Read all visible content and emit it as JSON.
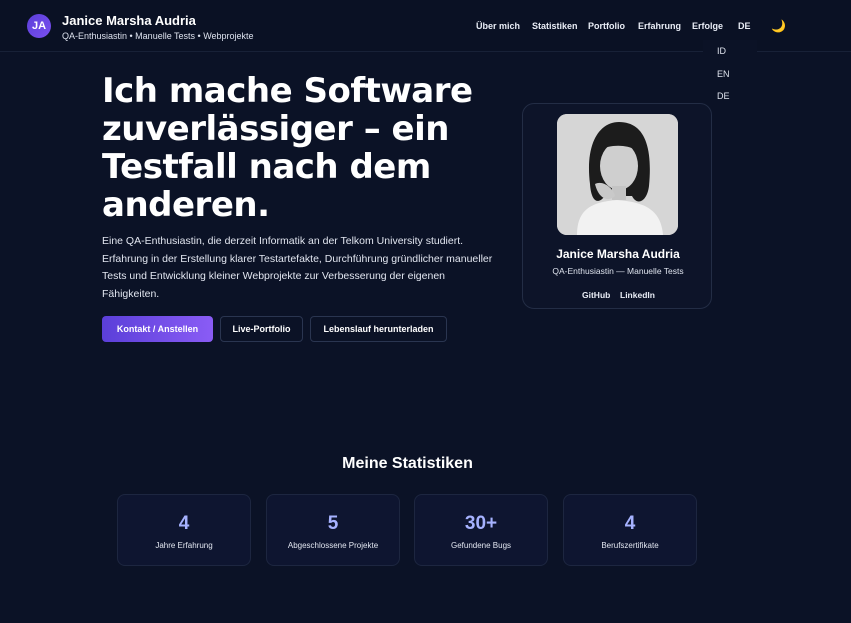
{
  "header": {
    "avatar_initials": "JA",
    "name": "Janice Marsha Audria",
    "subtitle": "QA-Enthusiastin • Manuelle Tests • Webprojekte",
    "nav": [
      "Über mich",
      "Statistiken",
      "Portfolio",
      "Erfahrung",
      "Erfolge"
    ],
    "language_current": "DE",
    "language_options": [
      "ID",
      "EN",
      "DE"
    ],
    "theme_icon": "moon-icon"
  },
  "hero": {
    "title": "Ich mache Software zuverlässiger – ein Testfall nach dem anderen.",
    "description": "Eine QA-Enthusiastin, die derzeit Informatik an der Telkom University studiert. Erfahrung in der Erstellung klarer Testartefakte, Durchführung gründlicher manueller Tests und Entwicklung kleiner Webprojekte zur Verbesserung der eigenen Fähigkeiten.",
    "buttons": {
      "contact": "Kontakt / Anstellen",
      "portfolio": "Live-Portfolio",
      "cv": "Lebenslauf herunterladen"
    }
  },
  "profile": {
    "name": "Janice Marsha Audria",
    "role": "QA-Enthusiastin — Manuelle Tests",
    "links": [
      "GitHub",
      "LinkedIn"
    ]
  },
  "stats": {
    "heading": "Meine Statistiken",
    "items": [
      {
        "value": "4",
        "label": "Jahre Erfahrung"
      },
      {
        "value": "5",
        "label": "Abgeschlossene Projekte"
      },
      {
        "value": "30+",
        "label": "Gefundene Bugs"
      },
      {
        "value": "4",
        "label": "Berufszertifikate"
      }
    ]
  },
  "colors": {
    "background": "#0b1226",
    "accent": "#5b3fd9",
    "stat_value": "#a6b2ff"
  }
}
